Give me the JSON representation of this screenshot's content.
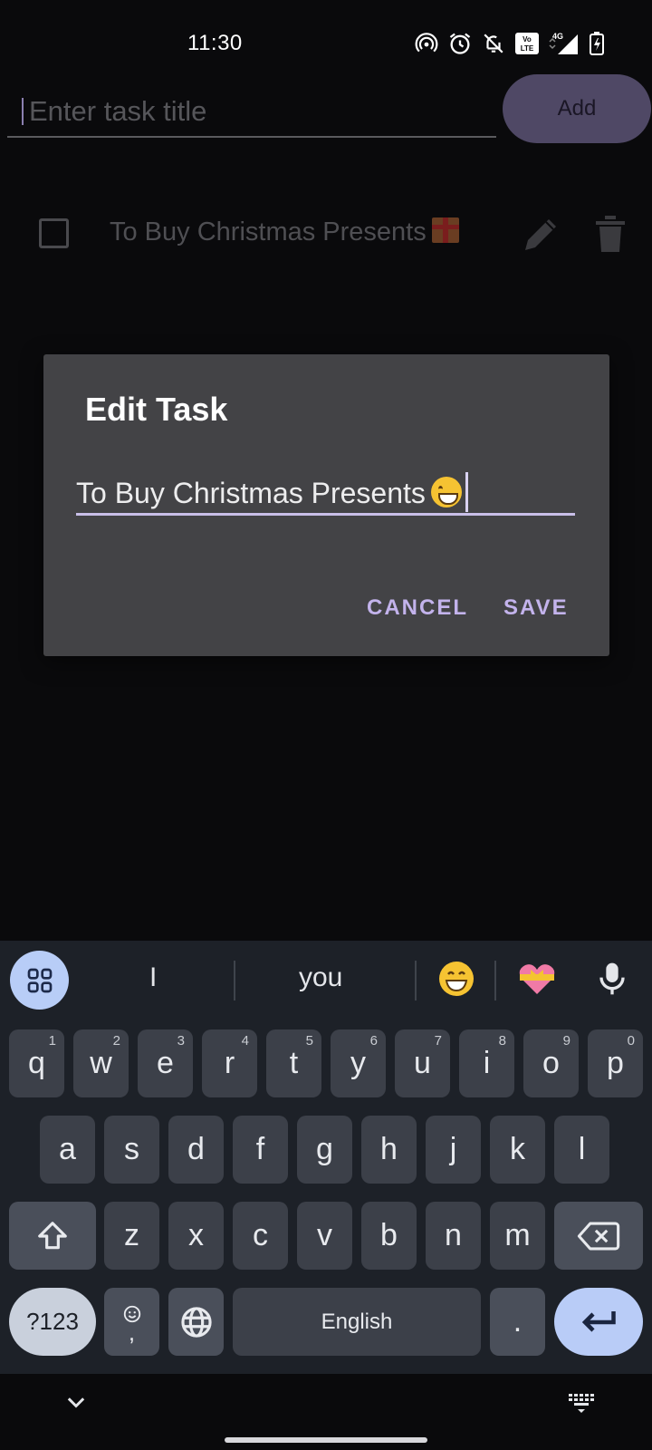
{
  "status_bar": {
    "time": "11:30",
    "icons": [
      "hotspot-icon",
      "alarm-icon",
      "notifications-off-icon",
      "volte-icon",
      "4g-signal-icon",
      "battery-charging-icon"
    ],
    "network_label": "4G"
  },
  "header": {
    "title_placeholder": "Enter task title",
    "add_label": "Add"
  },
  "tasks": [
    {
      "title": "To Buy Christmas Presents",
      "emoji": "gift",
      "checked": false
    }
  ],
  "dialog": {
    "title": "Edit Task",
    "field_value": "To Buy Christmas Presents",
    "field_emoji": "grinning-face",
    "cancel_label": "CANCEL",
    "save_label": "SAVE"
  },
  "keyboard": {
    "suggestions": [
      "I",
      "you"
    ],
    "emoji_suggestions": [
      "grinning-face",
      "heart-with-ribbon"
    ],
    "row1": [
      {
        "key": "q",
        "hint": "1"
      },
      {
        "key": "w",
        "hint": "2"
      },
      {
        "key": "e",
        "hint": "3"
      },
      {
        "key": "r",
        "hint": "4"
      },
      {
        "key": "t",
        "hint": "5"
      },
      {
        "key": "y",
        "hint": "6"
      },
      {
        "key": "u",
        "hint": "7"
      },
      {
        "key": "i",
        "hint": "8"
      },
      {
        "key": "o",
        "hint": "9"
      },
      {
        "key": "p",
        "hint": "0"
      }
    ],
    "row2": [
      "a",
      "s",
      "d",
      "f",
      "g",
      "h",
      "j",
      "k",
      "l"
    ],
    "row3": [
      "z",
      "x",
      "c",
      "v",
      "b",
      "n",
      "m"
    ],
    "symbols_label": "?123",
    "comma_label": ",",
    "space_label": "English",
    "period_label": "."
  },
  "colors": {
    "background": "#0a0a0c",
    "accent": "#c3b3ec",
    "dialog": "#434346",
    "keyboard": "#1d2128",
    "key": "#3c4049"
  }
}
